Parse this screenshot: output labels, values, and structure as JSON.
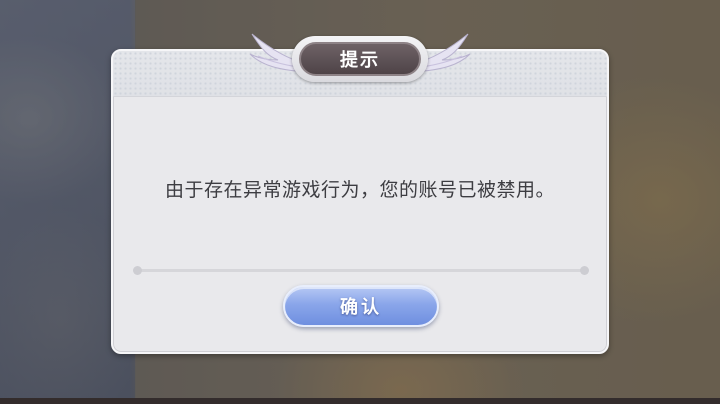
{
  "dialog": {
    "title": "提示",
    "message": "由于存在异常游戏行为，您的账号已被禁用。",
    "confirm_label": "确认"
  },
  "colors": {
    "button_gradient_top": "#b6c8f4",
    "button_gradient_bottom": "#6f8fe0",
    "title_plate": "#5b4f53",
    "dialog_bg": "#e9e9ec"
  }
}
